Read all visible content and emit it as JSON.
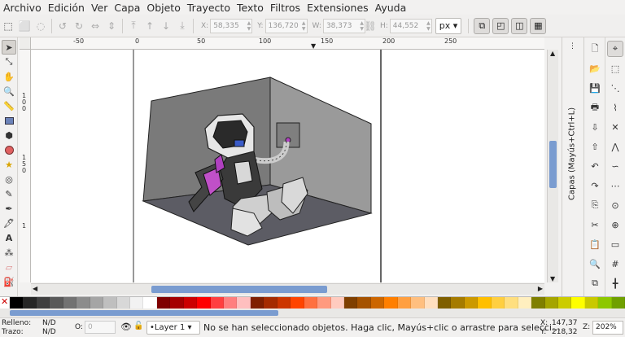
{
  "menu": [
    "Archivo",
    "Edición",
    "Ver",
    "Capa",
    "Objeto",
    "Trayecto",
    "Texto",
    "Filtros",
    "Extensiones",
    "Ayuda"
  ],
  "controls": {
    "x_label": "X:",
    "x_value": "58,335",
    "y_label": "Y:",
    "y_value": "136,720",
    "w_label": "W:",
    "w_value": "38,373",
    "h_label": "H:",
    "h_value": "44,552",
    "unit": "px"
  },
  "ruler": {
    "h_labels": [
      "-50",
      "0",
      "50",
      "100",
      "150",
      "200",
      "250"
    ],
    "v_labels": [
      "1",
      "0",
      "0",
      "1",
      "5",
      "0",
      "1"
    ]
  },
  "layers_panel": {
    "title": "Capas (Mayús+Ctrl+L)"
  },
  "status": {
    "fill_label": "Relleno:",
    "fill_value": "N/D",
    "stroke_label": "Trazo:",
    "stroke_value": "N/D",
    "opacity_label": "O:",
    "opacity_value": "0",
    "layer": "•Layer 1",
    "message": "No se han seleccionado objetos. Haga clic, Mayús+clic o arrastre para selecci…",
    "x_label": "X:",
    "x_value": "147,37",
    "y_label": "Y:",
    "y_value": "218,32",
    "zoom_label": "Z:",
    "zoom_value": "202%"
  },
  "palette": [
    "#000000",
    "#262626",
    "#3f3f3f",
    "#595959",
    "#727272",
    "#8c8c8c",
    "#a5a5a5",
    "#bfbfbf",
    "#d8d8d8",
    "#f2f2f2",
    "#ffffff",
    "#7f0000",
    "#a50000",
    "#cc0000",
    "#ff0000",
    "#ff3f3f",
    "#ff7f7f",
    "#ffbfbf",
    "#7f1f00",
    "#a52b00",
    "#cc3500",
    "#ff4400",
    "#ff7040",
    "#ff9a7f",
    "#ffcbbf",
    "#7f3f00",
    "#a55200",
    "#cc6600",
    "#ff7f00",
    "#ff9f40",
    "#ffbf7f",
    "#ffdfbf",
    "#7f5f00",
    "#a57b00",
    "#cc9900",
    "#ffbf00",
    "#ffcf40",
    "#ffdf7f",
    "#ffefbf",
    "#7f7f00",
    "#a5a500",
    "#cccc00",
    "#ffff00",
    "#c9c900",
    "#8dc800",
    "#6fa000"
  ],
  "colors": {
    "accent": "#7a9cd0",
    "canvas": "#ffffff",
    "chrome": "#f2f1f0"
  }
}
